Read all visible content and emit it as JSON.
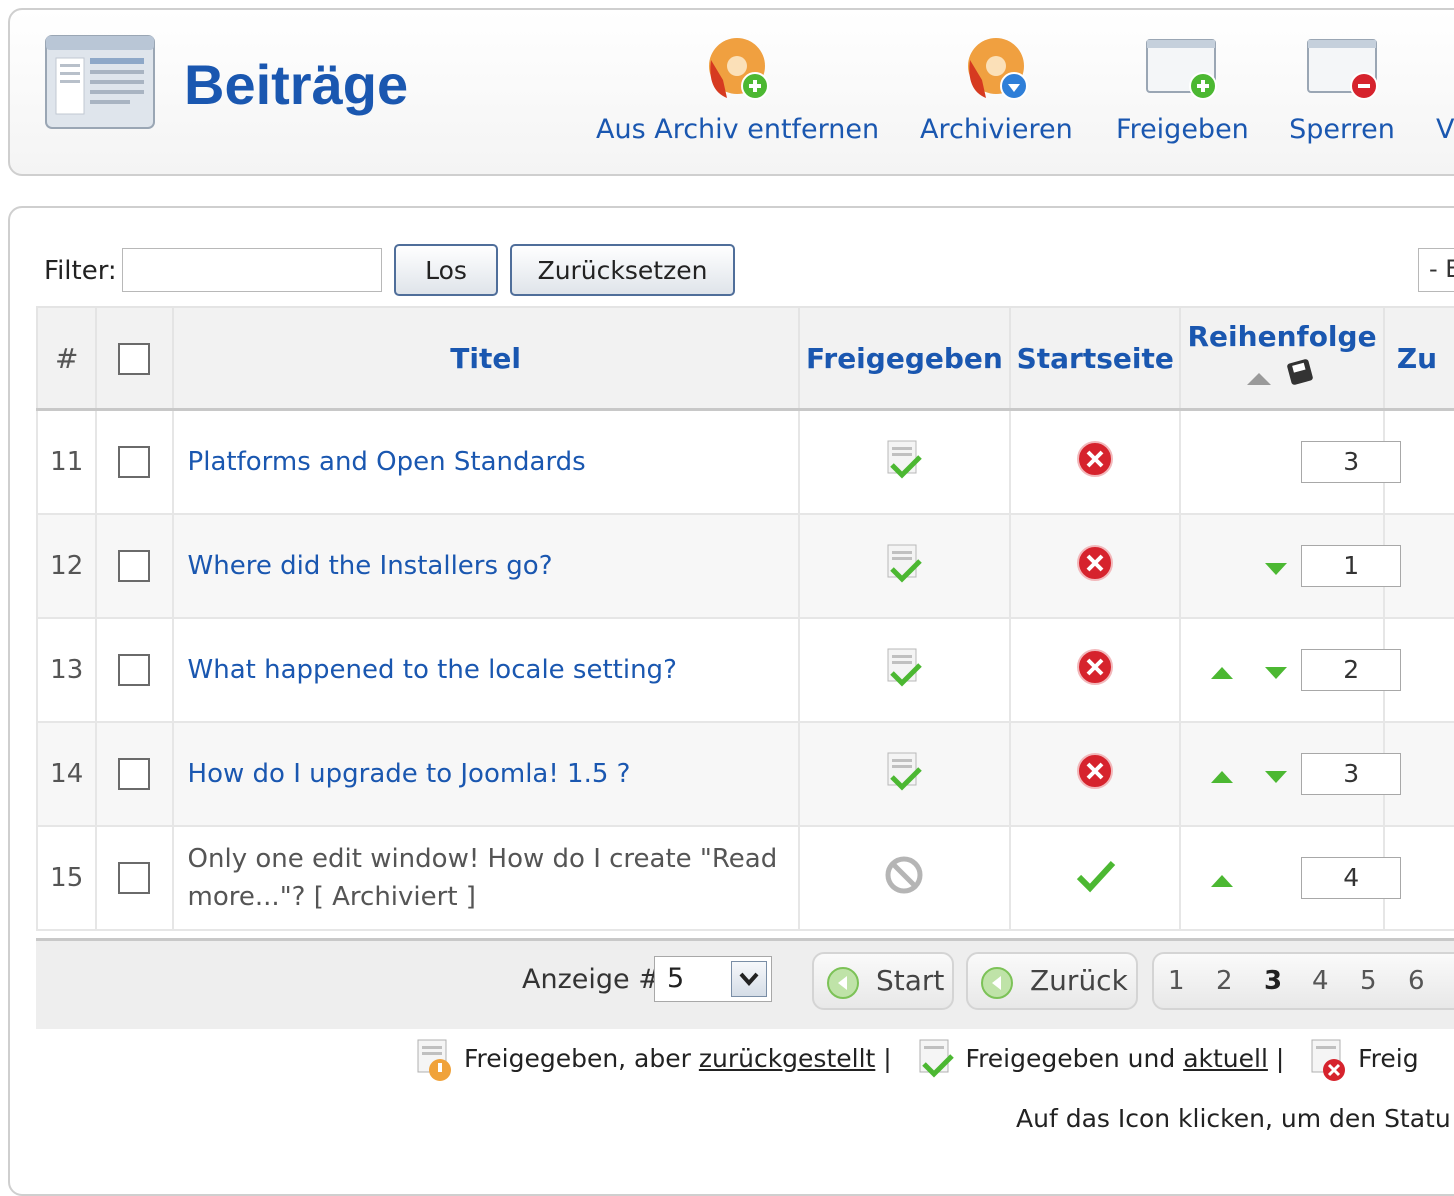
{
  "header": {
    "title": "Beiträge",
    "toolbar": [
      {
        "label": "Aus Archiv entfernen",
        "icon": "unarchive-icon"
      },
      {
        "label": "Archivieren",
        "icon": "archive-icon"
      },
      {
        "label": "Freigeben",
        "icon": "publish-icon"
      },
      {
        "label": "Sperren",
        "icon": "unpublish-icon"
      },
      {
        "label": "V",
        "icon": "more-icon"
      }
    ]
  },
  "filter": {
    "label": "Filter:",
    "value": "",
    "go_label": "Los",
    "reset_label": "Zurücksetzen",
    "select_value": "- E"
  },
  "table": {
    "columns": {
      "num": "#",
      "title": "Titel",
      "published": "Freigegeben",
      "frontpage": "Startseite",
      "order": "Reihenfolge",
      "access": "Zu"
    },
    "rows": [
      {
        "num": "11",
        "title": "Platforms and Open Standards",
        "archived_label": "",
        "published": "published",
        "frontpage": "no",
        "order": "3",
        "up": false,
        "down": false
      },
      {
        "num": "12",
        "title": "Where did the Installers go?",
        "archived_label": "",
        "published": "published",
        "frontpage": "no",
        "order": "1",
        "up": false,
        "down": true
      },
      {
        "num": "13",
        "title": "What happened to the locale setting?",
        "archived_label": "",
        "published": "published",
        "frontpage": "no",
        "order": "2",
        "up": true,
        "down": true
      },
      {
        "num": "14",
        "title": "How do I upgrade to Joomla! 1.5 ?",
        "archived_label": "",
        "published": "published",
        "frontpage": "no",
        "order": "3",
        "up": true,
        "down": true
      },
      {
        "num": "15",
        "title": "Only one edit window! How do I create \"Read more...\"?",
        "archived_label": "[ Archiviert ]",
        "published": "archived",
        "frontpage": "yes",
        "order": "4",
        "up": true,
        "down": false
      }
    ]
  },
  "pagination": {
    "display_label": "Anzeige #",
    "display_value": "5",
    "start_label": "Start",
    "prev_label": "Zurück",
    "pages": [
      "1",
      "2",
      "3",
      "4",
      "5",
      "6"
    ],
    "current_page": "3"
  },
  "legend": {
    "pending_text": "Freigegeben, aber ",
    "pending_link": "zurückgestellt",
    "current_text": "Freigegeben und ",
    "current_link": "aktuell",
    "sep": "|",
    "expired_text": "Freig",
    "hint": "Auf das Icon klicken, um den Statu"
  },
  "colors": {
    "accent": "#1a57b0",
    "green": "#4cb832",
    "red": "#d6232d"
  }
}
